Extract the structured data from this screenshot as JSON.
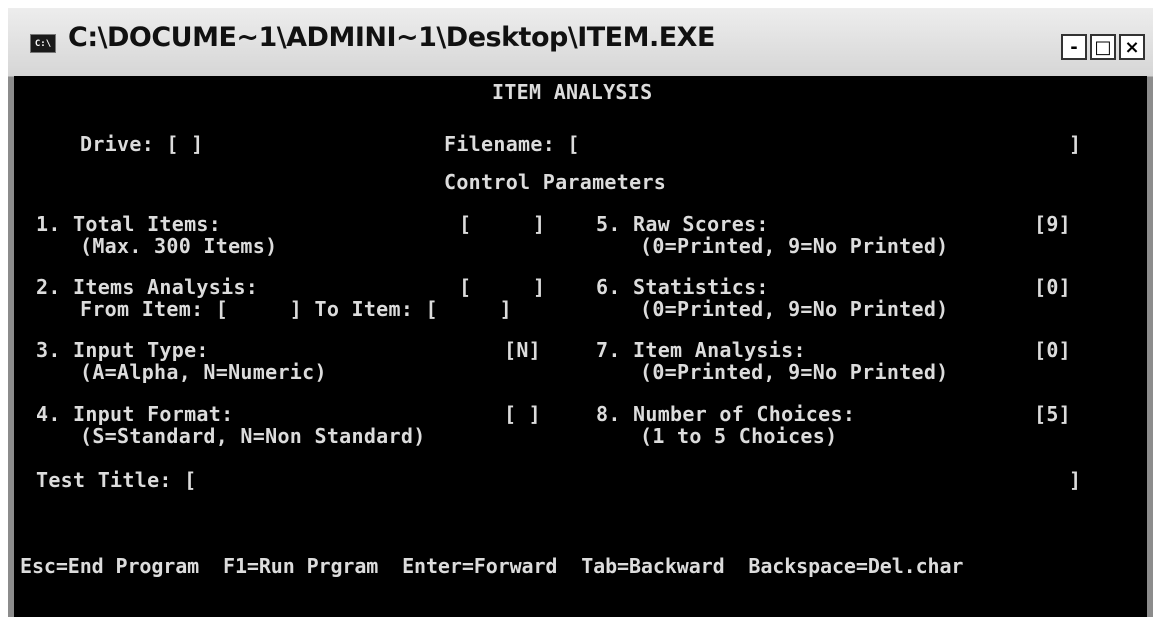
{
  "window": {
    "title": "C:\\DOCUME~1\\ADMINI~1\\Desktop\\ITEM.EXE",
    "system_icon": "console-icon",
    "controls": {
      "minimize": "-",
      "maximize": "□",
      "close": "×"
    }
  },
  "screen": {
    "heading": "ITEM ANALYSIS",
    "drive_label": "Drive: [ ]",
    "filename_label": "Filename: [",
    "filename_close": "]",
    "section_title": "Control Parameters",
    "params_left": [
      {
        "label": "1. Total Items:",
        "value": "[     ]",
        "hint": "(Max. 300 Items)"
      },
      {
        "label": "2. Items Analysis:",
        "value": "[     ]",
        "hint": "From Item: [     ] To Item: [     ]"
      },
      {
        "label": "3. Input Type:",
        "value": "[N]",
        "hint": "(A=Alpha, N=Numeric)"
      },
      {
        "label": "4. Input Format:",
        "value": "[ ]",
        "hint": "(S=Standard, N=Non Standard)"
      }
    ],
    "params_right": [
      {
        "label": "5. Raw Scores:",
        "value": "[9]",
        "hint": "(0=Printed, 9=No Printed)"
      },
      {
        "label": "6. Statistics:",
        "value": "[0]",
        "hint": "(0=Printed, 9=No Printed)"
      },
      {
        "label": "7. Item Analysis:",
        "value": "[0]",
        "hint": "(0=Printed, 9=No Printed)"
      },
      {
        "label": "8. Number of Choices:",
        "value": "[5]",
        "hint": "(1 to 5 Choices)"
      }
    ],
    "test_title_label": "Test Title: [",
    "test_title_close": "]",
    "footer_keys": "Esc=End Program  F1=Run Prgram  Enter=Forward  Tab=Backward  Backspace=Del.char"
  }
}
